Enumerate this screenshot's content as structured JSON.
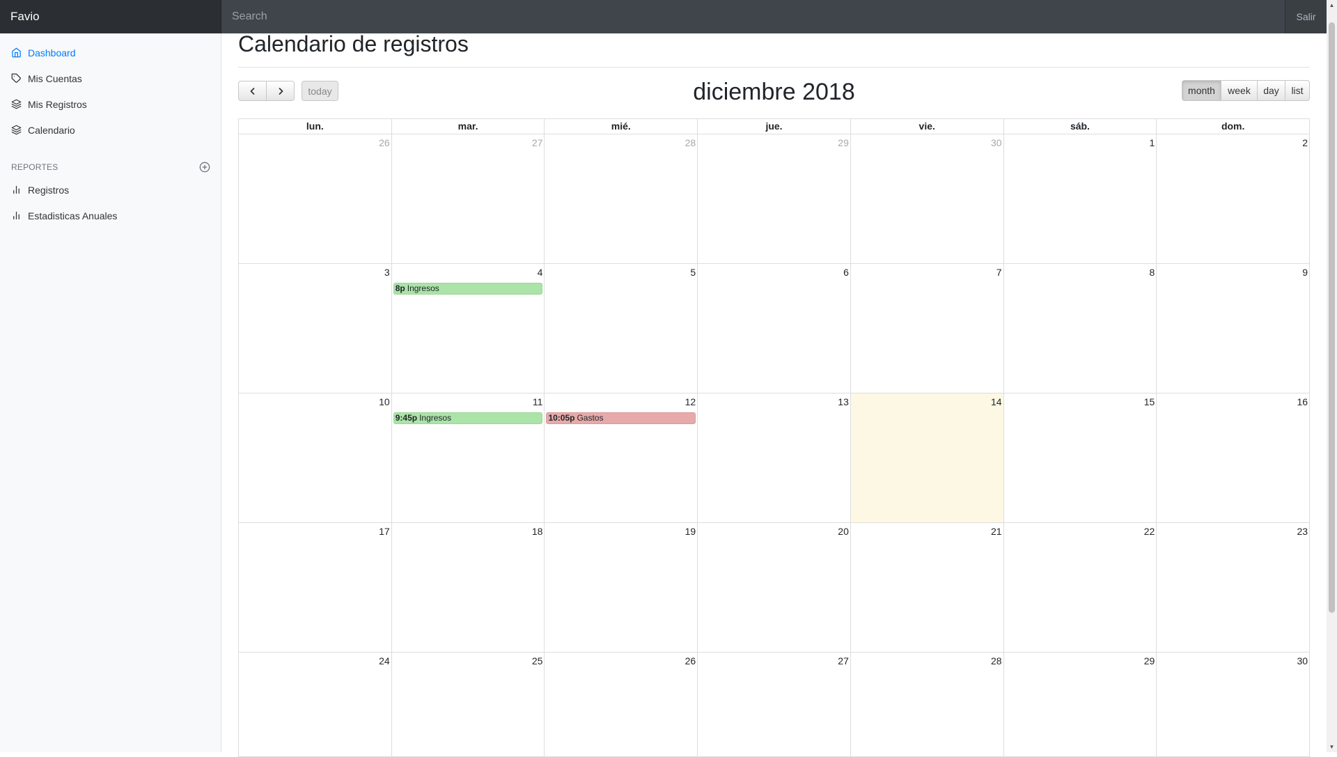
{
  "app": {
    "brand": "Favio",
    "search_placeholder": "Search",
    "signout_label": "Salir"
  },
  "sidebar": {
    "items": [
      {
        "label": "Dashboard",
        "icon": "home-icon",
        "active": true
      },
      {
        "label": "Mis Cuentas",
        "icon": "tag-icon",
        "active": false
      },
      {
        "label": "Mis Registros",
        "icon": "layers-icon",
        "active": false
      },
      {
        "label": "Calendario",
        "icon": "layers-icon",
        "active": false
      }
    ],
    "reports_heading": "REPORTES",
    "reports": [
      {
        "label": "Registros",
        "icon": "bar-chart-icon"
      },
      {
        "label": "Estadisticas Anuales",
        "icon": "bar-chart-icon"
      }
    ]
  },
  "page": {
    "title": "Calendario de registros"
  },
  "calendar": {
    "title": "diciembre 2018",
    "today_label": "today",
    "views": [
      "month",
      "week",
      "day",
      "list"
    ],
    "active_view": "month",
    "weekdays": [
      "lun.",
      "mar.",
      "mié.",
      "jue.",
      "vie.",
      "sáb.",
      "dom."
    ],
    "weeks": [
      [
        {
          "d": "26",
          "other": true
        },
        {
          "d": "27",
          "other": true
        },
        {
          "d": "28",
          "other": true
        },
        {
          "d": "29",
          "other": true
        },
        {
          "d": "30",
          "other": true
        },
        {
          "d": "1"
        },
        {
          "d": "2"
        }
      ],
      [
        {
          "d": "3"
        },
        {
          "d": "4",
          "event": {
            "time": "8p",
            "title": "Ingresos",
            "kind": "income"
          }
        },
        {
          "d": "5"
        },
        {
          "d": "6"
        },
        {
          "d": "7"
        },
        {
          "d": "8"
        },
        {
          "d": "9"
        }
      ],
      [
        {
          "d": "10"
        },
        {
          "d": "11",
          "event": {
            "time": "9:45p",
            "title": "Ingresos",
            "kind": "income"
          }
        },
        {
          "d": "12",
          "event": {
            "time": "10:05p",
            "title": "Gastos",
            "kind": "expense"
          }
        },
        {
          "d": "13"
        },
        {
          "d": "14",
          "today": true
        },
        {
          "d": "15"
        },
        {
          "d": "16"
        }
      ],
      [
        {
          "d": "17"
        },
        {
          "d": "18"
        },
        {
          "d": "19"
        },
        {
          "d": "20"
        },
        {
          "d": "21"
        },
        {
          "d": "22"
        },
        {
          "d": "23"
        }
      ],
      [
        {
          "d": "24"
        },
        {
          "d": "25"
        },
        {
          "d": "26"
        },
        {
          "d": "27"
        },
        {
          "d": "28"
        },
        {
          "d": "29"
        },
        {
          "d": "30"
        }
      ]
    ],
    "colors": {
      "income": "#abe3a8",
      "expense": "#e6aaaa",
      "today": "#fcf8e3"
    }
  }
}
